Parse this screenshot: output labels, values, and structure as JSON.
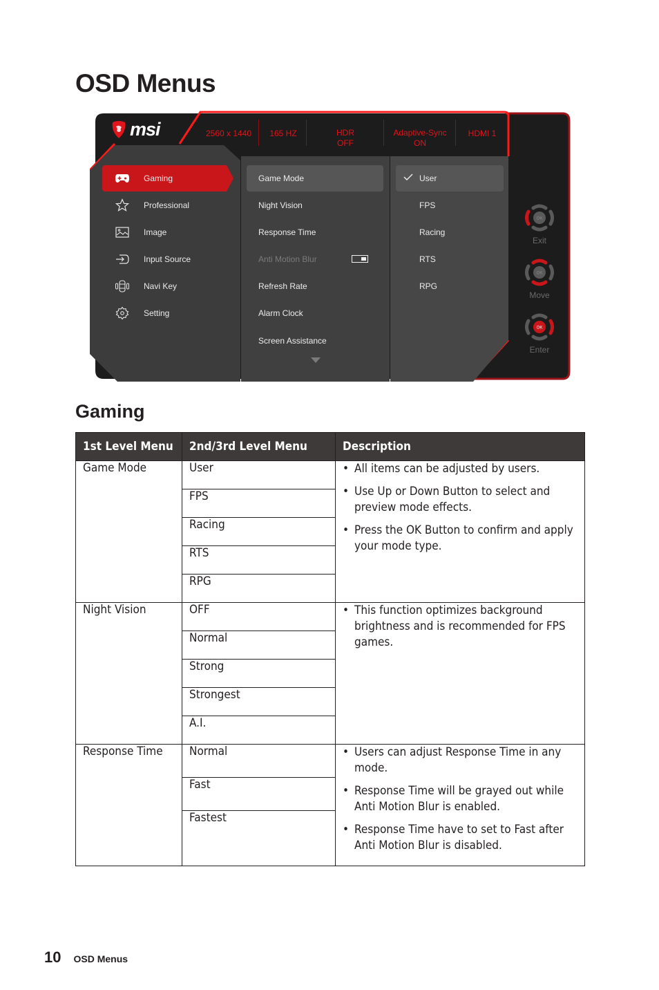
{
  "page": {
    "title": "OSD Menus",
    "section_title": "Gaming",
    "footer": {
      "page_number": "10",
      "section": "OSD Menus"
    }
  },
  "osd": {
    "brand": "msi",
    "colors": {
      "accent": "#e0141a",
      "active_nav": "#c8161a",
      "panel_dark": "#1c1c1c",
      "panel_mid": "#3e3e3e",
      "panel_light": "#454545",
      "highlight": "#565656"
    },
    "status_bar": [
      {
        "line1": "2560 x 1440",
        "line2": ""
      },
      {
        "line1": "165 HZ",
        "line2": ""
      },
      {
        "line1": "HDR",
        "line2": "OFF"
      },
      {
        "line1": "Adaptive-Sync",
        "line2": "ON"
      },
      {
        "line1": "HDMI 1",
        "line2": ""
      }
    ],
    "nav_items": [
      {
        "label": "Gaming",
        "icon": "gamepad-icon",
        "active": true
      },
      {
        "label": "Professional",
        "icon": "star-icon",
        "active": false
      },
      {
        "label": "Image",
        "icon": "image-icon",
        "active": false
      },
      {
        "label": "Input Source",
        "icon": "input-source-icon",
        "active": false
      },
      {
        "label": "Navi Key",
        "icon": "navi-key-icon",
        "active": false
      },
      {
        "label": "Setting",
        "icon": "gear-icon",
        "active": false
      }
    ],
    "sub_items": [
      {
        "label": "Game Mode",
        "active": true
      },
      {
        "label": "Night Vision"
      },
      {
        "label": "Response Time"
      },
      {
        "label": "Anti Motion Blur",
        "disabled": true,
        "toggle": "on"
      },
      {
        "label": "Refresh Rate"
      },
      {
        "label": "Alarm Clock"
      },
      {
        "label": "Screen Assistance"
      }
    ],
    "options": [
      {
        "label": "User",
        "checked": true
      },
      {
        "label": "FPS"
      },
      {
        "label": "Racing"
      },
      {
        "label": "RTS"
      },
      {
        "label": "RPG"
      }
    ],
    "key_hints": [
      {
        "label": "Exit",
        "highlight": "left"
      },
      {
        "label": "Move",
        "highlight": "up-down"
      },
      {
        "label": "Enter",
        "highlight": "ok-right"
      }
    ],
    "key_ok_label": "OK"
  },
  "table": {
    "headers": [
      "1st Level Menu",
      "2nd/3rd Level Menu",
      "Description"
    ],
    "groups": [
      {
        "menu": "Game Mode",
        "options": [
          "User",
          "FPS",
          "Racing",
          "RTS",
          "RPG"
        ],
        "description": [
          "All items can be adjusted by users.",
          "Use Up or Down Button to select and preview mode effects.",
          "Press the OK Button to confirm and apply your mode type."
        ]
      },
      {
        "menu": "Night Vision",
        "options": [
          "OFF",
          "Normal",
          "Strong",
          "Strongest",
          "A.I."
        ],
        "description": [
          "This function optimizes background brightness and is recommended for FPS games."
        ]
      },
      {
        "menu": "Response Time",
        "options": [
          "Normal",
          "Fast",
          "Fastest"
        ],
        "description": [
          "Users can adjust Response Time in any mode.",
          "Response Time will be grayed out while Anti Motion Blur is enabled.",
          "Response Time have to set to Fast after Anti Motion Blur is disabled."
        ]
      }
    ]
  }
}
